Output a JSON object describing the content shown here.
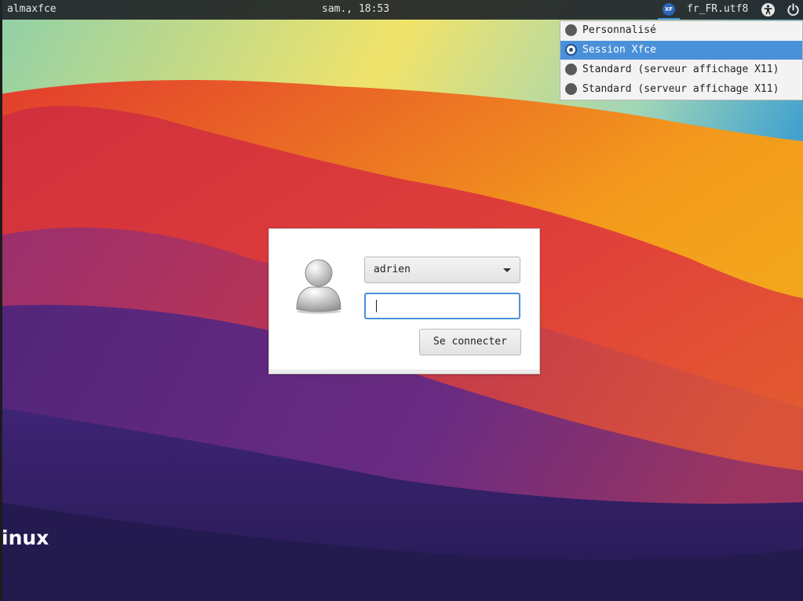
{
  "top_panel": {
    "hostname": "almaxfce",
    "clock": "sam., 18:53",
    "session_icon": "xfce-session-icon",
    "language": "fr_FR.utf8",
    "accessibility_icon": "accessibility-icon",
    "power_icon": "power-icon"
  },
  "session_menu": {
    "items": [
      {
        "label": "Personnalisé",
        "selected": false
      },
      {
        "label": "Session Xfce",
        "selected": true
      },
      {
        "label": "Standard (serveur affichage X11)",
        "selected": false
      },
      {
        "label": "Standard (serveur affichage X11)",
        "selected": false
      }
    ]
  },
  "login": {
    "avatar_icon": "user-avatar-icon",
    "username": "adrien",
    "password": "",
    "login_button": "Se connecter"
  },
  "wallpaper": {
    "brand_fragment": "inux"
  },
  "colors": {
    "accent": "#4a90d9",
    "panel": "#202428"
  }
}
